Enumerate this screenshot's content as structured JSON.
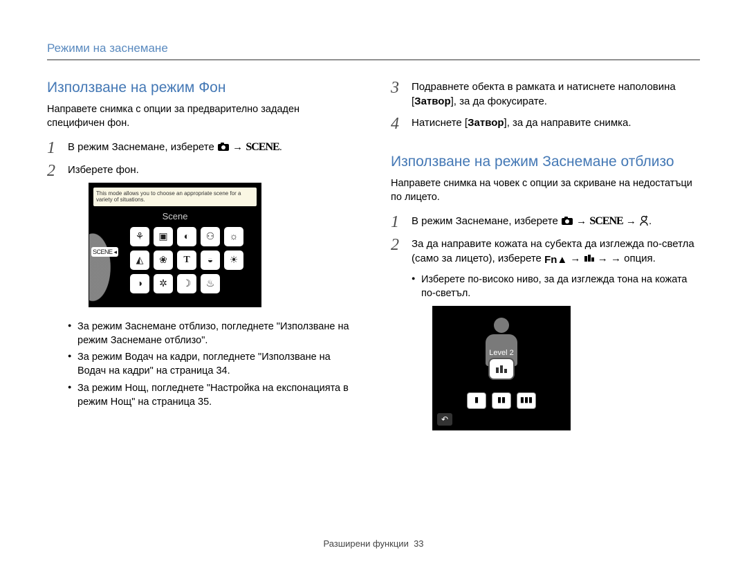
{
  "header": {
    "breadcrumb": "Режими на заснемане"
  },
  "left": {
    "title": "Използване на режим Фон",
    "intro": "Направете снимка с опции за предварително зададен специфичен фон.",
    "step1_a": "В режим Заснемане, изберете ",
    "step1_scene": "SCENE",
    "step2": "Изберете фон.",
    "hint": "This mode allows you to choose an appropriate scene for a variety of situations.",
    "scene_label": "Scene",
    "left_badge": "SCENE ◂",
    "bullets": [
      "За режим Заснемане отблизо, погледнете \"Използване на режим Заснемане отблизо\".",
      "За режим Водач на кадри, погледнете \"Използване на Водач на кадри\" на страница 34.",
      "За режим Нощ, погледнете \"Настройка на експонацията в режим Нощ\" на страница 35."
    ]
  },
  "right": {
    "step3_a": "Подравнете обекта в рамката и натиснете наполовина [",
    "step3_b": "Затвор",
    "step3_c": "], за да фокусирате.",
    "step4_a": "Натиснете [",
    "step4_b": "Затвор",
    "step4_c": "], за да направите снимка.",
    "title2": "Използване на режим Заснемане отблизо",
    "intro2": "Направете снимка на човек с опции за скриване на недостатъци по лицето.",
    "r_step1": "В режим Заснемане, изберете ",
    "r_step1_scene": "SCENE",
    "r_step2_a": "За да направите кожата на субекта да изглежда по-светла (само за лицето), изберете ",
    "r_step2_b": " → опция.",
    "r_bullet": "Изберете по-високо ниво, за да изглежда тона на кожата по-светъл.",
    "level_label": "Level 2"
  },
  "footer": {
    "section": "Разширени функции",
    "page": "33"
  }
}
